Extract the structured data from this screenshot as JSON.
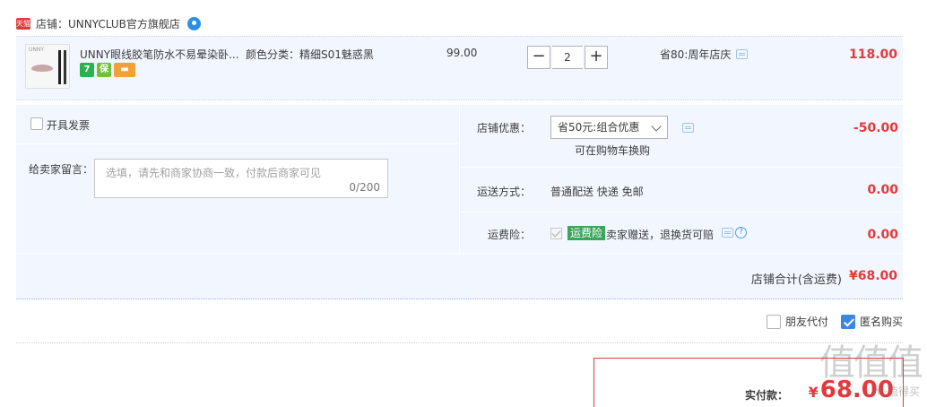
{
  "shop": {
    "tmall_label": "天猫",
    "name": "店铺：UNNYCLUB官方旗舰店"
  },
  "item": {
    "thumb_brand": "UNNY",
    "title": "UNNY眼线胶笔防水不易晕染卧...",
    "sku": "颜色分类：精细S01魅惑黑",
    "price": "99.00",
    "quantity": "2",
    "qty_minus": "−",
    "qty_plus": "+",
    "promo": "省80:周年店庆",
    "total": "118.00",
    "badges": [
      "7",
      "保",
      "▬"
    ]
  },
  "invoice": {
    "label": "开具发票"
  },
  "note": {
    "label": "给卖家留言：",
    "placeholder": "选填，请先和商家协商一致，付款后商家可见",
    "count": "0/200"
  },
  "discount": {
    "label": "店铺优惠：",
    "selected": "省50元:组合优惠",
    "hint": "可在购物车换购",
    "amount": "-50.00"
  },
  "shipping": {
    "label": "运送方式：",
    "method": "普通配送 快递 免邮",
    "amount": "0.00"
  },
  "insurance": {
    "label": "运费险：",
    "tag": "运费险",
    "text": "卖家赠送，退换货可赔",
    "help": "?",
    "amount": "0.00"
  },
  "subtotal": {
    "label": "店铺合计(含运费)",
    "amount": "¥68.00"
  },
  "options": {
    "friend_pay": "朋友代付",
    "friend_pay_checked": false,
    "anonymous": "匿名购买",
    "anonymous_checked": true
  },
  "payment": {
    "label": "实付款：",
    "yen": "¥",
    "amount": "68.00"
  },
  "watermark": {
    "text": "值值值",
    "sub": "nt·值得买"
  },
  "colors": {
    "accent_red": "#e4393c",
    "panel_blue": "#f2f7ff",
    "check_blue": "#3d87e0",
    "insurance_green": "#3ba55c"
  },
  "icons": [
    "tmall-icon",
    "wangwang-icon",
    "message-icon",
    "chevron-down-icon",
    "help-icon",
    "checkbox-icon"
  ]
}
